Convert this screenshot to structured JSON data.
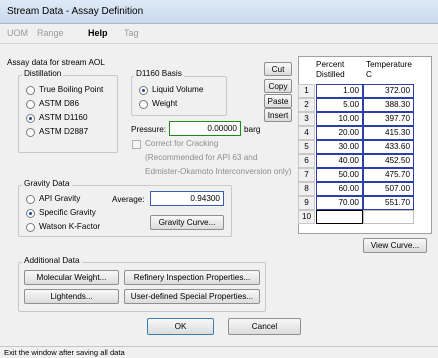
{
  "window": {
    "title": "Stream Data - Assay Definition"
  },
  "menu": {
    "items": [
      "UOM",
      "Range",
      "Help",
      "Tag"
    ]
  },
  "assay_label": "Assay data for stream AOL",
  "distillation": {
    "title": "Distillation",
    "options": [
      "True Boiling Point",
      "ASTM D86",
      "ASTM D1160",
      "ASTM D2887"
    ],
    "selected": "ASTM D1160"
  },
  "d1160": {
    "title": "D1160 Basis",
    "options": [
      "Liquid Volume",
      "Weight"
    ],
    "selected": "Liquid Volume"
  },
  "pressure": {
    "label": "Pressure:",
    "value": "0.00000",
    "unit": "barg"
  },
  "cracking": {
    "label": "Correct for Cracking",
    "note1": "(Recommended for API 63 and",
    "note2": "Edmister-Okamoto Interconversion only)"
  },
  "gravity": {
    "title": "Gravity Data",
    "options": [
      "API Gravity",
      "Specific Gravity",
      "Watson K-Factor"
    ],
    "selected": "Specific Gravity",
    "average_label": "Average:",
    "average_value": "0.94300",
    "curve_button": "Gravity Curve..."
  },
  "edit_buttons": [
    "Cut",
    "Copy",
    "Paste",
    "Insert"
  ],
  "table": {
    "headers": [
      [
        "Percent",
        "Distilled"
      ],
      [
        "Temperature",
        "C"
      ]
    ],
    "rows": [
      {
        "n": "1",
        "pct": "1.00",
        "temp": "372.00"
      },
      {
        "n": "2",
        "pct": "5.00",
        "temp": "388.30"
      },
      {
        "n": "3",
        "pct": "10.00",
        "temp": "397.70"
      },
      {
        "n": "4",
        "pct": "20.00",
        "temp": "415.30"
      },
      {
        "n": "5",
        "pct": "30.00",
        "temp": "433.60"
      },
      {
        "n": "6",
        "pct": "40.00",
        "temp": "452.50"
      },
      {
        "n": "7",
        "pct": "50.00",
        "temp": "475.70"
      },
      {
        "n": "8",
        "pct": "60.00",
        "temp": "507.00"
      },
      {
        "n": "9",
        "pct": "70.00",
        "temp": "551.70"
      },
      {
        "n": "10",
        "pct": "",
        "temp": ""
      }
    ]
  },
  "view_curve_button": "View Curve...",
  "additional": {
    "title": "Additional Data",
    "buttons": [
      "Molecular Weight...",
      "Refinery Inspection Properties...",
      "Lightends...",
      "User-defined Special Properties..."
    ]
  },
  "ok_button": "OK",
  "cancel_button": "Cancel",
  "status": "Exit the window after saving all data"
}
